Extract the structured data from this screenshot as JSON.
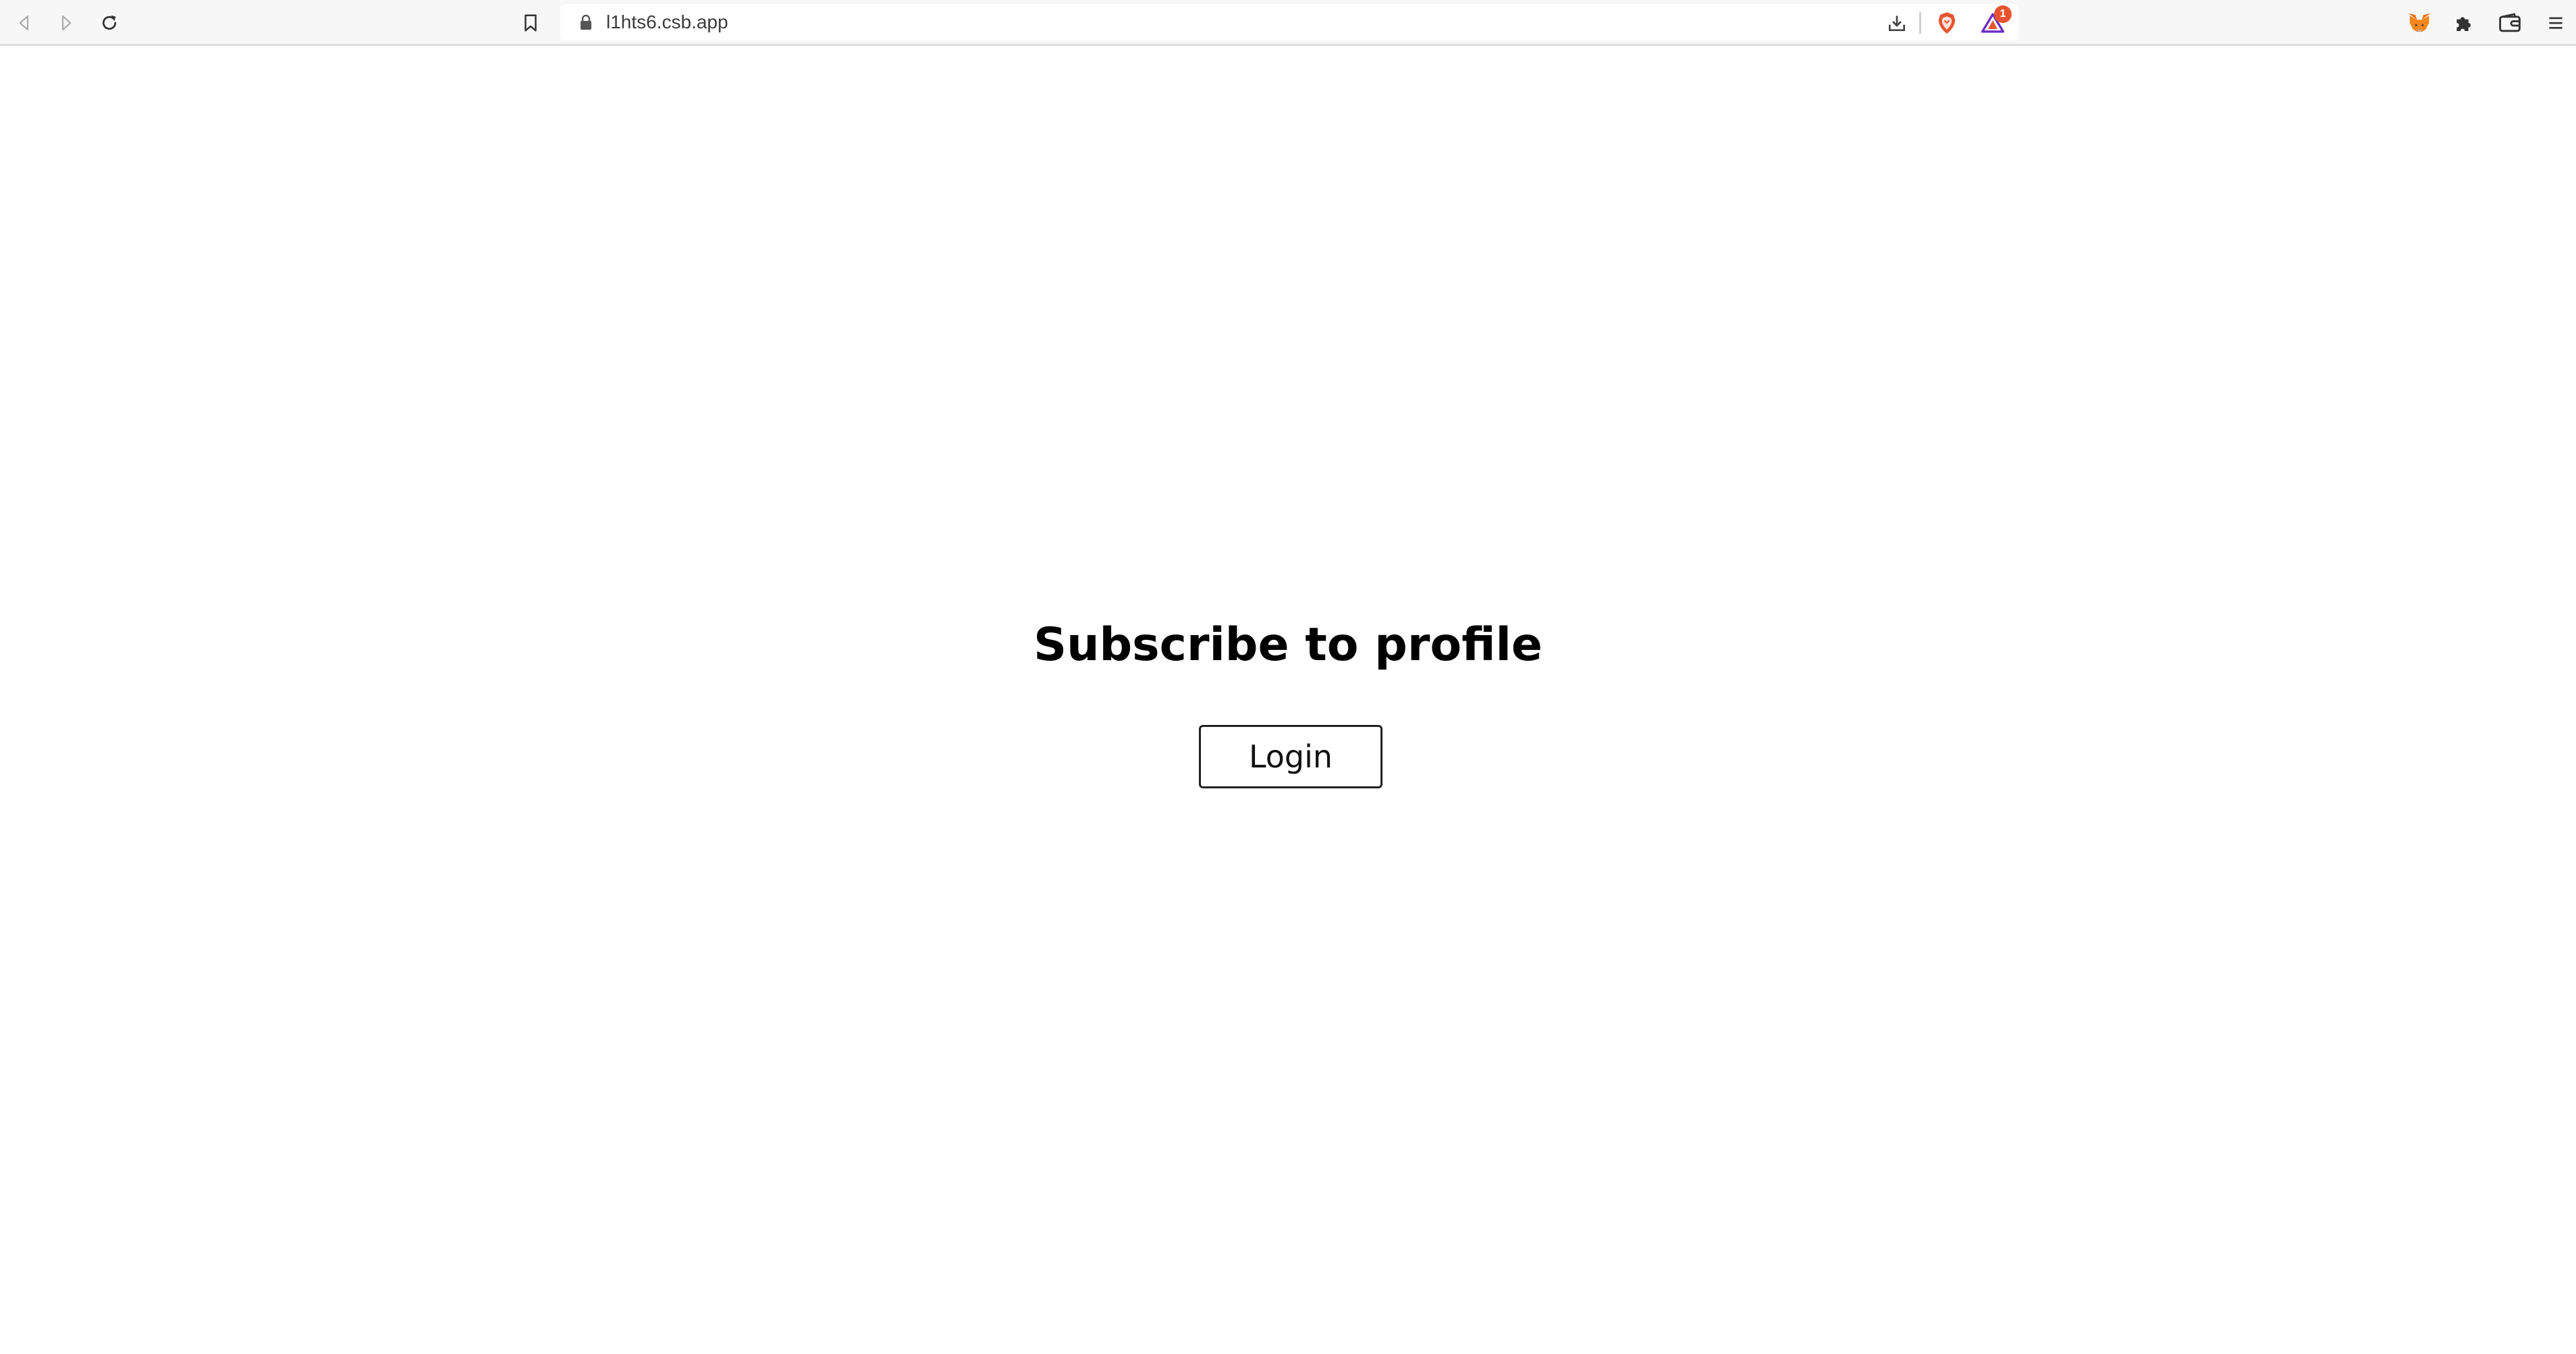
{
  "browser": {
    "url": "l1hts6.csb.app",
    "rewards_badge_count": "1",
    "icons": {
      "back": "back-arrow-icon",
      "forward": "forward-arrow-icon",
      "reload": "reload-icon",
      "bookmark": "bookmark-icon",
      "lock": "lock-icon",
      "download": "download-icon",
      "brave_shields": "brave-shields-icon",
      "brave_rewards": "brave-rewards-icon",
      "metamask": "metamask-fox-icon",
      "extensions": "puzzle-piece-icon",
      "wallet": "wallet-icon",
      "menu": "hamburger-menu-icon"
    }
  },
  "page": {
    "title": "Subscribe to profile",
    "login_label": "Login"
  },
  "colors": {
    "toolbar_bg": "#f7f7f7",
    "page_bg": "#ffffff",
    "brave_orange": "#e8532f",
    "text": "#000000"
  }
}
